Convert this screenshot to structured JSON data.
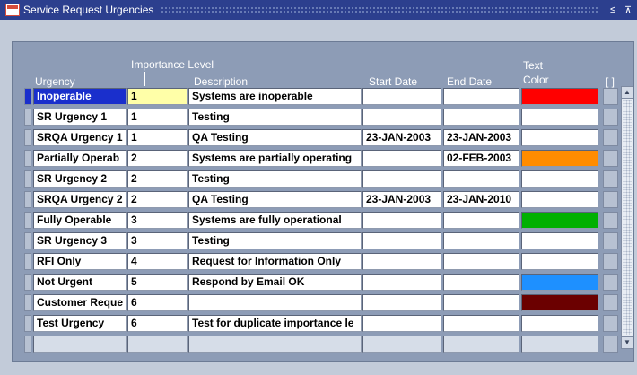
{
  "window": {
    "title": "Service Request Urgencies",
    "minimize": "≤",
    "maximize": "⊼"
  },
  "headers": {
    "urgency": "Urgency",
    "importance_level": "Importance Level",
    "description": "Description",
    "start_date": "Start Date",
    "end_date": "End Date",
    "text_color_1": "Text",
    "text_color_2": "Color",
    "flex": "[ ]"
  },
  "rows": [
    {
      "urgency": "Inoperable",
      "level": "1",
      "description": "Systems are inoperable",
      "start": "",
      "end": "",
      "color": "#ff0000"
    },
    {
      "urgency": "SR Urgency 1",
      "level": "1",
      "description": "Testing",
      "start": "",
      "end": "",
      "color": ""
    },
    {
      "urgency": "SRQA Urgency 1",
      "level": "1",
      "description": "QA Testing",
      "start": "23-JAN-2003",
      "end": "23-JAN-2003",
      "color": ""
    },
    {
      "urgency": "Partially Operab",
      "level": "2",
      "description": "Systems are partially operating",
      "start": "",
      "end": "02-FEB-2003",
      "color": "#ff8c00"
    },
    {
      "urgency": "SR Urgency 2",
      "level": "2",
      "description": "Testing",
      "start": "",
      "end": "",
      "color": ""
    },
    {
      "urgency": "SRQA Urgency 2",
      "level": "2",
      "description": "QA Testing",
      "start": "23-JAN-2003",
      "end": "23-JAN-2010",
      "color": ""
    },
    {
      "urgency": "Fully Operable",
      "level": "3",
      "description": "Systems are fully operational",
      "start": "",
      "end": "",
      "color": "#00b000"
    },
    {
      "urgency": "SR Urgency 3",
      "level": "3",
      "description": "Testing",
      "start": "",
      "end": "",
      "color": ""
    },
    {
      "urgency": "RFI Only",
      "level": "4",
      "description": "Request for Information Only",
      "start": "",
      "end": "",
      "color": ""
    },
    {
      "urgency": "Not Urgent",
      "level": "5",
      "description": "Respond by Email OK",
      "start": "",
      "end": "",
      "color": "#1e90ff"
    },
    {
      "urgency": "Customer Reque",
      "level": "6",
      "description": "",
      "start": "",
      "end": "",
      "color": "#6b0000"
    },
    {
      "urgency": "Test Urgency",
      "level": "6",
      "description": "Test for duplicate importance le",
      "start": "",
      "end": "",
      "color": ""
    },
    {
      "urgency": "",
      "level": "",
      "description": "",
      "start": "",
      "end": "",
      "color": ""
    }
  ],
  "colors": {
    "title_bar": "#2c3f8e",
    "selection": "#1a2fcc",
    "level_highlight": "#ffffa8"
  },
  "icons": {
    "app": "oracle-forms-icon",
    "scroll_up": "scroll-up-arrow-icon",
    "scroll_down": "scroll-down-arrow-icon"
  }
}
